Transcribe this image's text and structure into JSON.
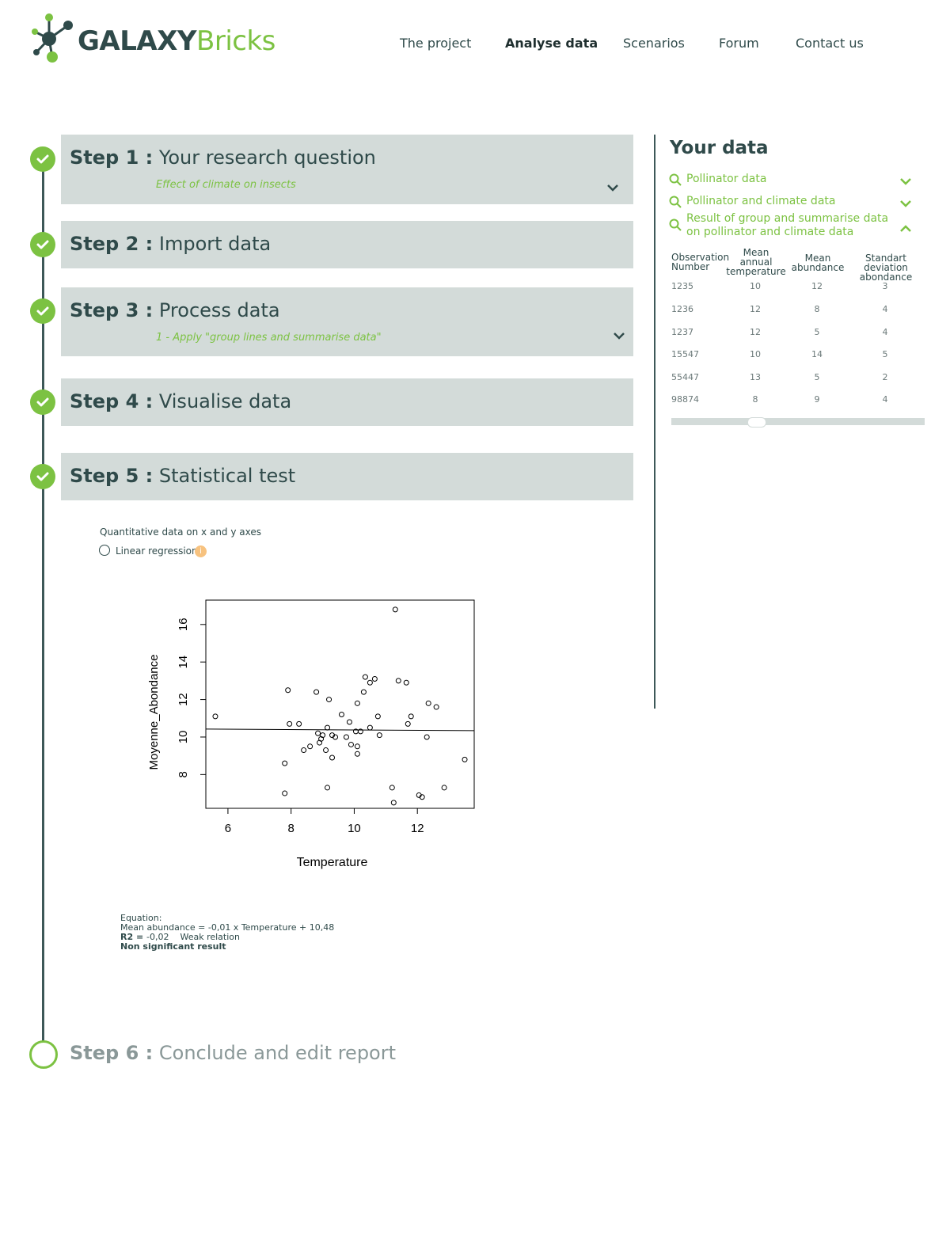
{
  "brand": {
    "part1": "GALAXY",
    "part2": "Bricks"
  },
  "nav": [
    {
      "label": "The project",
      "active": false
    },
    {
      "label": "Analyse data",
      "active": true
    },
    {
      "label": "Scenarios",
      "active": false
    },
    {
      "label": "Forum",
      "active": false
    },
    {
      "label": "Contact us",
      "active": false
    }
  ],
  "steps": [
    {
      "prefix": "Step 1 :",
      "title": "Your research question",
      "sub": "Effect of climate on insects",
      "done": true
    },
    {
      "prefix": "Step 2 :",
      "title": "Import data",
      "done": true
    },
    {
      "prefix": "Step 3 :",
      "title": "Process data",
      "sub": "1 - Apply \"group lines and summarise data\"",
      "done": true
    },
    {
      "prefix": "Step 4 :",
      "title": "Visualise data",
      "done": true
    },
    {
      "prefix": "Step 5 :",
      "title": "Statistical test",
      "done": true
    },
    {
      "prefix": "Step 6 :",
      "title": "Conclude and edit report",
      "done": false
    }
  ],
  "stat": {
    "question": "Quantitative data on x and y axes",
    "option": "Linear regression",
    "info_symbol": "i",
    "eq_label": "Equation:",
    "eq_line": "Mean abundance = -0,01 x Temperature + 10,48",
    "r2_label": "R2 = ",
    "r2_value": "-0,02",
    "r2_note": "Weak relation",
    "result": "Non significant result"
  },
  "sidebar": {
    "title": "Your data",
    "datasets": [
      {
        "label": "Pollinator data",
        "expanded": false
      },
      {
        "label": "Pollinator and climate data",
        "expanded": false
      },
      {
        "label_line1": "Result of group and summarise data",
        "label_line2": "on pollinator and climate data",
        "expanded": true
      }
    ],
    "table": {
      "headers": [
        [
          "Observation",
          "Number"
        ],
        [
          "Mean",
          "annual",
          "temperature"
        ],
        [
          "Mean",
          "abundance"
        ],
        [
          "Standart deviation",
          "abondance"
        ]
      ],
      "rows": [
        [
          "1235",
          "10",
          "12",
          "3"
        ],
        [
          "1236",
          "12",
          "8",
          "4"
        ],
        [
          "1237",
          "12",
          "5",
          "4"
        ],
        [
          "15547",
          "10",
          "14",
          "5"
        ],
        [
          "55447",
          "13",
          "5",
          "2"
        ],
        [
          "98874",
          "8",
          "9",
          "4"
        ]
      ]
    }
  },
  "colors": {
    "accent": "#7cc242",
    "dark": "#2f4a4a",
    "panel": "#d3dbd9",
    "info": "#f7c27f"
  },
  "chart_data": {
    "type": "scatter",
    "xlabel": "Temperature",
    "ylabel": "Moyenne_Abondance",
    "xlim": [
      5.3,
      13.8
    ],
    "ylim": [
      6.2,
      17.3
    ],
    "xticks": [
      6,
      8,
      10,
      12
    ],
    "yticks": [
      8,
      10,
      12,
      14,
      16
    ],
    "regression": {
      "intercept": 10.48,
      "slope": -0.01
    },
    "points": [
      [
        5.6,
        11.1
      ],
      [
        7.8,
        8.6
      ],
      [
        7.8,
        7.0
      ],
      [
        7.9,
        12.5
      ],
      [
        7.95,
        10.7
      ],
      [
        8.25,
        10.7
      ],
      [
        8.4,
        9.3
      ],
      [
        8.6,
        9.5
      ],
      [
        8.8,
        12.4
      ],
      [
        8.85,
        10.2
      ],
      [
        8.9,
        9.7
      ],
      [
        8.95,
        9.9
      ],
      [
        9.0,
        10.1
      ],
      [
        9.1,
        9.3
      ],
      [
        9.15,
        10.5
      ],
      [
        9.15,
        7.3
      ],
      [
        9.2,
        12.0
      ],
      [
        9.3,
        8.9
      ],
      [
        9.3,
        10.1
      ],
      [
        9.4,
        10.0
      ],
      [
        9.6,
        11.2
      ],
      [
        9.75,
        10.0
      ],
      [
        9.85,
        10.8
      ],
      [
        9.9,
        9.6
      ],
      [
        10.05,
        10.3
      ],
      [
        10.1,
        11.8
      ],
      [
        10.1,
        9.5
      ],
      [
        10.1,
        9.1
      ],
      [
        10.2,
        10.3
      ],
      [
        10.3,
        12.4
      ],
      [
        10.35,
        13.2
      ],
      [
        10.5,
        12.9
      ],
      [
        10.5,
        10.5
      ],
      [
        10.65,
        13.1
      ],
      [
        10.75,
        11.1
      ],
      [
        10.8,
        10.1
      ],
      [
        11.2,
        7.3
      ],
      [
        11.25,
        6.5
      ],
      [
        11.3,
        16.8
      ],
      [
        11.4,
        13.0
      ],
      [
        11.65,
        12.9
      ],
      [
        11.7,
        10.7
      ],
      [
        11.8,
        11.1
      ],
      [
        12.05,
        6.9
      ],
      [
        12.15,
        6.8
      ],
      [
        12.3,
        10.0
      ],
      [
        12.35,
        11.8
      ],
      [
        12.6,
        11.6
      ],
      [
        12.85,
        7.3
      ],
      [
        13.5,
        8.8
      ]
    ]
  }
}
